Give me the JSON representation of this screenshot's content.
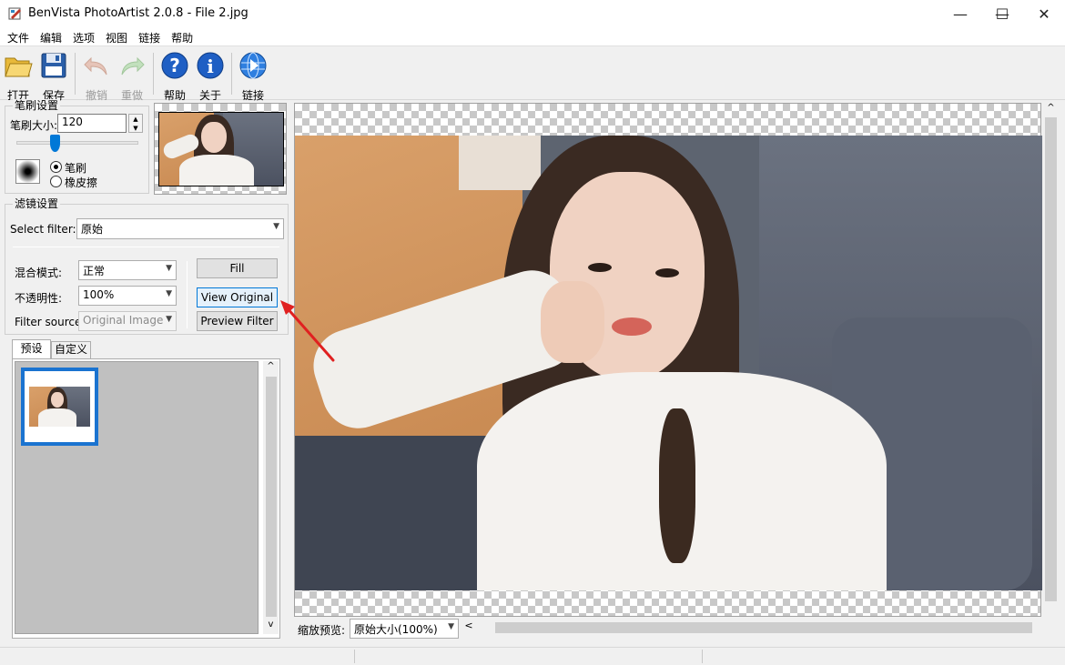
{
  "window": {
    "title": "BenVista PhotoArtist 2.0.8 - File 2.jpg",
    "min_glyph": "—",
    "max_glyph": "☐",
    "close_glyph": "✕"
  },
  "menu": [
    "文件",
    "编辑",
    "选项",
    "视图",
    "链接",
    "帮助"
  ],
  "toolbar": {
    "open": "打开",
    "save": "保存",
    "undo": "撤销",
    "redo": "重做",
    "help": "帮助",
    "about": "关于",
    "link": "链接"
  },
  "brush": {
    "group_title": "笔刷设置",
    "size_label": "笔刷大小:",
    "size_value": "120",
    "slider_fraction": 0.3,
    "option_brush": "笔刷",
    "option_eraser": "橡皮擦",
    "selected": "brush"
  },
  "filter": {
    "group_title": "滤镜设置",
    "select_label": "Select filter:",
    "select_value": "原始",
    "blend_label": "混合模式:",
    "blend_value": "正常",
    "opacity_label": "不透明性:",
    "opacity_value": "100%",
    "source_label": "Filter source:",
    "source_value": "Original Image",
    "fill_button": "Fill",
    "view_original_button": "View Original",
    "preview_filter_button": "Preview Filter"
  },
  "tabs": {
    "preset": "预设",
    "custom": "自定义",
    "active": "preset"
  },
  "zoom": {
    "label": "缩放预览:",
    "value": "原始大小(100%)"
  },
  "icons": {
    "open": "folder-open-icon",
    "save": "floppy-disk-icon",
    "undo": "undo-arrow-icon",
    "redo": "redo-arrow-icon",
    "help": "question-icon",
    "about": "info-icon",
    "link": "globe-link-icon"
  },
  "colors": {
    "accent": "#1a73d0",
    "annotation_arrow": "#e02020"
  }
}
